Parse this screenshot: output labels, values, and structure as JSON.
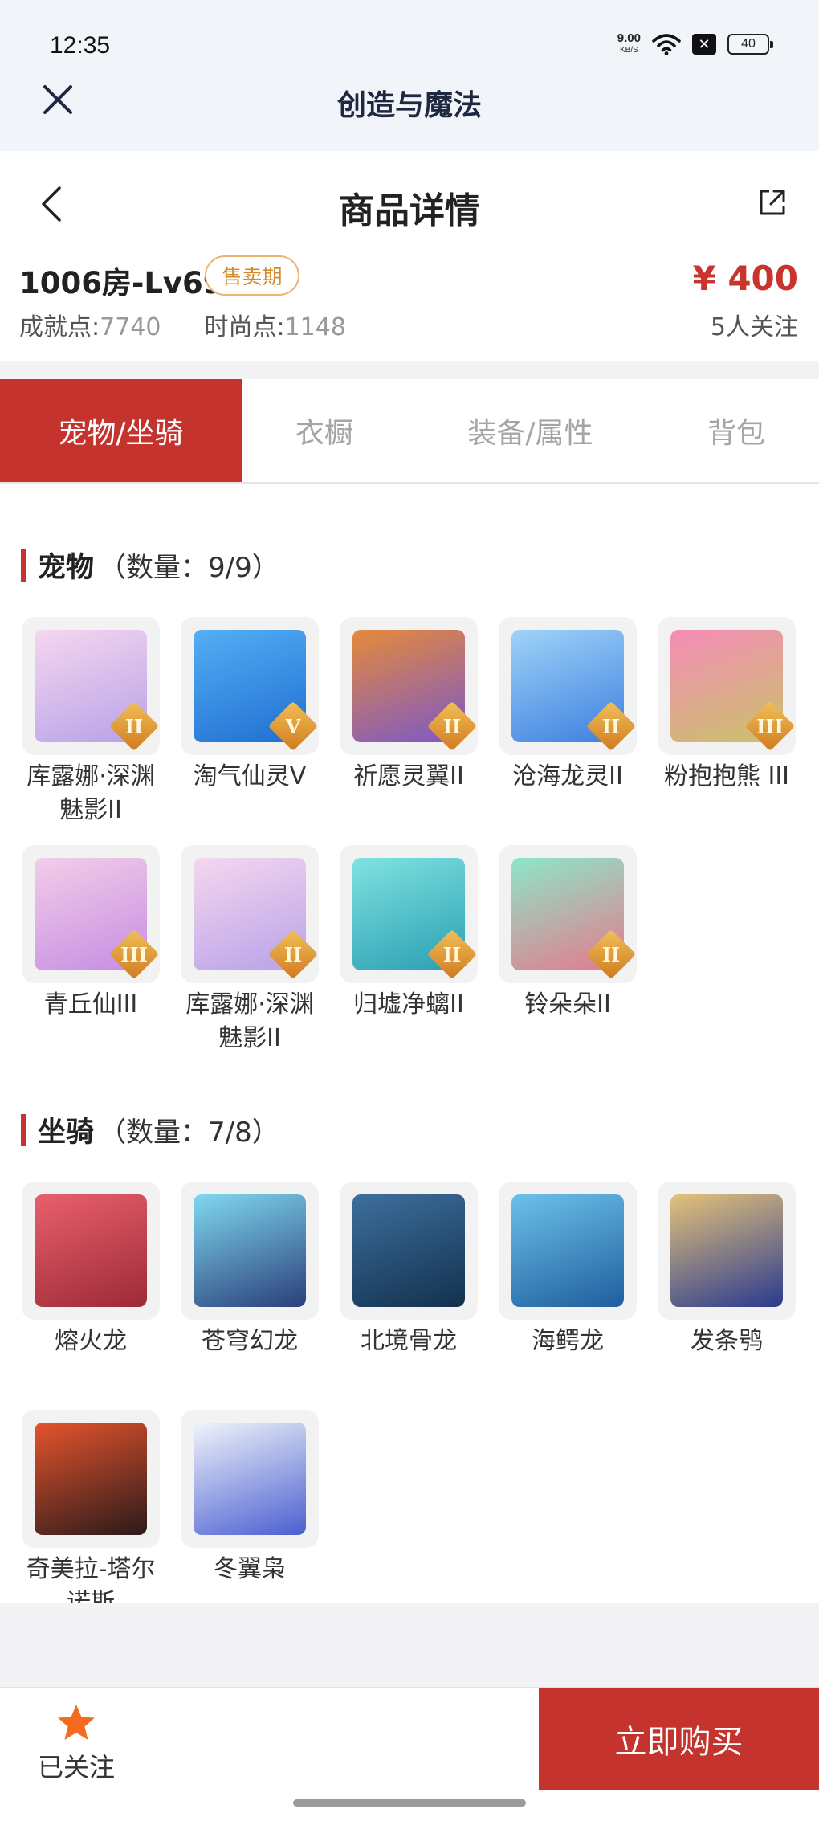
{
  "status": {
    "time": "12:35",
    "speed": "9.00",
    "speed_unit": "KB/S",
    "battery": "40"
  },
  "app": {
    "title": "创造与魔法"
  },
  "header": {
    "title": "商品详情"
  },
  "listing": {
    "room": "1006房-Lv69",
    "badge": "售卖期",
    "price": "¥ 400",
    "achievement_label": "成就点:",
    "achievement_value": "7740",
    "fashion_label": "时尚点:",
    "fashion_value": "1148",
    "followers": "5人关注"
  },
  "tabs": [
    {
      "label": "宠物/坐骑",
      "active": true
    },
    {
      "label": "衣橱",
      "active": false
    },
    {
      "label": "装备/属性",
      "active": false
    },
    {
      "label": "背包",
      "active": false
    }
  ],
  "pets": {
    "title": "宠物",
    "count": "（数量：9/9）",
    "items": [
      {
        "name": "库露娜·深渊魅影II",
        "rank": "II",
        "icon": "pet-kuluna-icon",
        "colors": [
          "#f5d7ef",
          "#b8a1e8"
        ]
      },
      {
        "name": "淘气仙灵V",
        "rank": "V",
        "icon": "pet-taoqi-icon",
        "colors": [
          "#55aef5",
          "#1f6fd1"
        ]
      },
      {
        "name": "祈愿灵翼II",
        "rank": "II",
        "icon": "pet-qiyuan-icon",
        "colors": [
          "#e58a3a",
          "#7b58c9"
        ]
      },
      {
        "name": "沧海龙灵II",
        "rank": "II",
        "icon": "pet-canghai-icon",
        "colors": [
          "#9fd3f8",
          "#3d7fe0"
        ]
      },
      {
        "name": "粉抱抱熊 III",
        "rank": "III",
        "icon": "pet-bear-icon",
        "colors": [
          "#f58cb7",
          "#c9c26a"
        ]
      },
      {
        "name": "青丘仙III",
        "rank": "III",
        "icon": "pet-qingqiu-icon",
        "colors": [
          "#f3cde8",
          "#c68de3"
        ]
      },
      {
        "name": "库露娜·深渊魅影II",
        "rank": "II",
        "icon": "pet-kuluna-icon",
        "colors": [
          "#f5d7ef",
          "#b8a1e8"
        ]
      },
      {
        "name": "归墟净螭II",
        "rank": "II",
        "icon": "pet-guixu-icon",
        "colors": [
          "#7fe2e0",
          "#2a9fb3"
        ]
      },
      {
        "name": "铃朵朵II",
        "rank": "II",
        "icon": "pet-lingduo-icon",
        "colors": [
          "#8de6c8",
          "#e47a8d"
        ]
      }
    ]
  },
  "mounts": {
    "title": "坐骑",
    "count": "（数量：7/8）",
    "items": [
      {
        "name": "熔火龙",
        "icon": "mount-ronghuo-icon",
        "colors": [
          "#e8606b",
          "#9d2a37"
        ]
      },
      {
        "name": "苍穹幻龙",
        "icon": "mount-cangqiong-icon",
        "colors": [
          "#7fd8f0",
          "#2b3f7a"
        ]
      },
      {
        "name": "北境骨龙",
        "icon": "mount-beijing-icon",
        "colors": [
          "#3d6f9c",
          "#13314f"
        ]
      },
      {
        "name": "海鳄龙",
        "icon": "mount-haie-icon",
        "colors": [
          "#6cc1ea",
          "#1f5e9e"
        ]
      },
      {
        "name": "发条鸮",
        "icon": "mount-fatiao-icon",
        "colors": [
          "#e3c27a",
          "#2a3a8f"
        ]
      },
      {
        "name": "奇美拉-塔尔诺斯",
        "icon": "mount-chimera-icon",
        "colors": [
          "#e5542c",
          "#2a1a1a"
        ]
      },
      {
        "name": "冬翼枭",
        "icon": "mount-dongyi-icon",
        "colors": [
          "#f0f4fb",
          "#4b5fd0"
        ]
      }
    ]
  },
  "bottom": {
    "follow_label": "已关注",
    "buy_label": "立即购买"
  },
  "colors": {
    "accent": "#c4332d",
    "badge": "#d4892a",
    "star": "#f26b21"
  }
}
